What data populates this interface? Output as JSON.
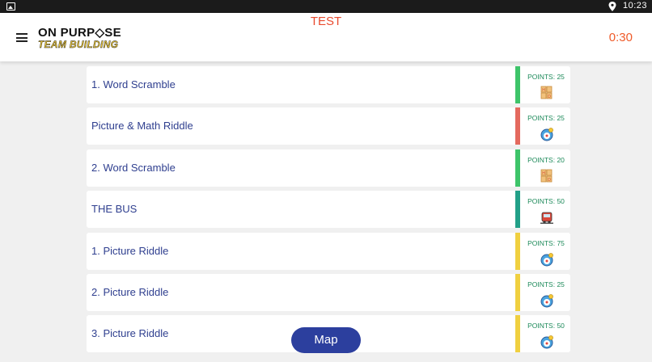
{
  "statusbar": {
    "time": "10:23"
  },
  "appbar": {
    "logo_line1": "ON PURP◇SE",
    "logo_line2": "TEAM BUILDING",
    "title": "TEST",
    "timer": "0:30"
  },
  "colors": {
    "green": "#3ec46a",
    "red": "#e46a5e",
    "teal": "#22a088",
    "yellow": "#f0d040",
    "title": "#e94b2f",
    "timer": "#ef5b2a",
    "label": "#2f3f8f",
    "points": "#1d8a5a",
    "map": "#2c3f9e"
  },
  "challenges": [
    {
      "label": "1. Word Scramble",
      "points": "POINTS: 25",
      "bar": "green",
      "icon": "scramble-icon"
    },
    {
      "label": "Picture & Math Riddle",
      "points": "POINTS: 25",
      "bar": "red",
      "icon": "riddle-icon"
    },
    {
      "label": "2. Word Scramble",
      "points": "POINTS: 20",
      "bar": "green",
      "icon": "scramble-icon"
    },
    {
      "label": "THE BUS",
      "points": "POINTS: 50",
      "bar": "teal",
      "icon": "bus-icon"
    },
    {
      "label": "1. Picture Riddle",
      "points": "POINTS: 75",
      "bar": "yellow",
      "icon": "riddle-icon"
    },
    {
      "label": "2. Picture Riddle",
      "points": "POINTS: 25",
      "bar": "yellow",
      "icon": "riddle-icon"
    },
    {
      "label": "3. Picture Riddle",
      "points": "POINTS: 50",
      "bar": "yellow",
      "icon": "riddle-icon"
    }
  ],
  "map_button": {
    "label": "Map"
  }
}
